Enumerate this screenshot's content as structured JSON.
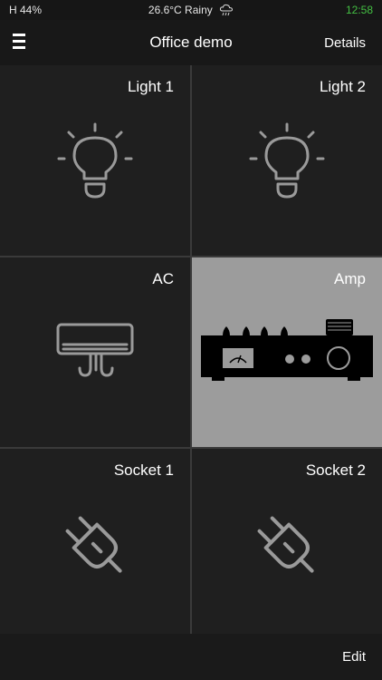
{
  "status": {
    "humidity": "H 44%",
    "weather": "26.6°C  Rainy",
    "weather_icon": "rain-cloud-icon",
    "time": "12:58",
    "time_color": "#44c043"
  },
  "header": {
    "menu_icon": "hamburger-menu-icon",
    "title": "Office demo",
    "details_label": "Details"
  },
  "devices": [
    {
      "name": "Light 1",
      "icon": "light-bulb-icon",
      "active": false
    },
    {
      "name": "Light 2",
      "icon": "light-bulb-icon",
      "active": false
    },
    {
      "name": "AC",
      "icon": "air-conditioner-icon",
      "active": false
    },
    {
      "name": "Amp",
      "icon": "amplifier-icon",
      "active": true
    },
    {
      "name": "Socket 1",
      "icon": "plug-icon",
      "active": false
    },
    {
      "name": "Socket 2",
      "icon": "plug-icon",
      "active": false
    }
  ],
  "footer": {
    "edit_label": "Edit"
  }
}
